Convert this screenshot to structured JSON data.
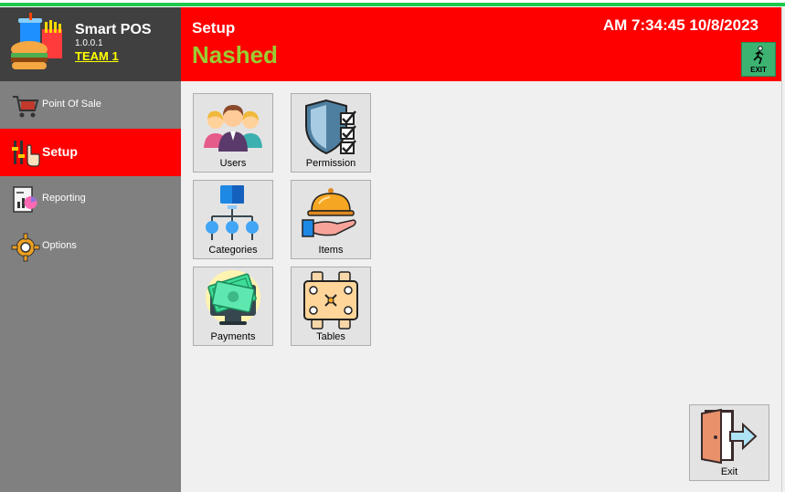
{
  "app": {
    "name": "Smart POS",
    "version": "1.0.0.1",
    "team": "TEAM 1"
  },
  "sidebar": {
    "items": [
      {
        "label": "Point Of Sale",
        "icon": "shopping-cart-icon",
        "active": false
      },
      {
        "label": "Setup",
        "icon": "settings-sliders-icon",
        "active": true
      },
      {
        "label": "Reporting",
        "icon": "report-icon",
        "active": false
      },
      {
        "label": "Options",
        "icon": "gear-icon",
        "active": false
      }
    ]
  },
  "header": {
    "title": "Setup",
    "user": "Nashed",
    "clock": "AM 7:34:45 10/8/2023",
    "exit_label": "EXIT"
  },
  "tiles": [
    {
      "label": "Users",
      "icon": "users-icon"
    },
    {
      "label": "Permission",
      "icon": "shield-checklist-icon"
    },
    {
      "label": "Categories",
      "icon": "hierarchy-icon"
    },
    {
      "label": "Items",
      "icon": "serving-dish-icon"
    },
    {
      "label": "Payments",
      "icon": "money-monitor-icon"
    },
    {
      "label": "Tables",
      "icon": "dining-table-icon"
    }
  ],
  "exit_tile": {
    "label": "Exit",
    "icon": "exit-door-icon"
  },
  "colors": {
    "accent_red": "#ff0000",
    "sidebar_gray": "#808080",
    "brand_dark": "#404040",
    "user_green": "#9acd32",
    "team_yellow": "#ffff00",
    "exit_green": "#3cb371"
  }
}
